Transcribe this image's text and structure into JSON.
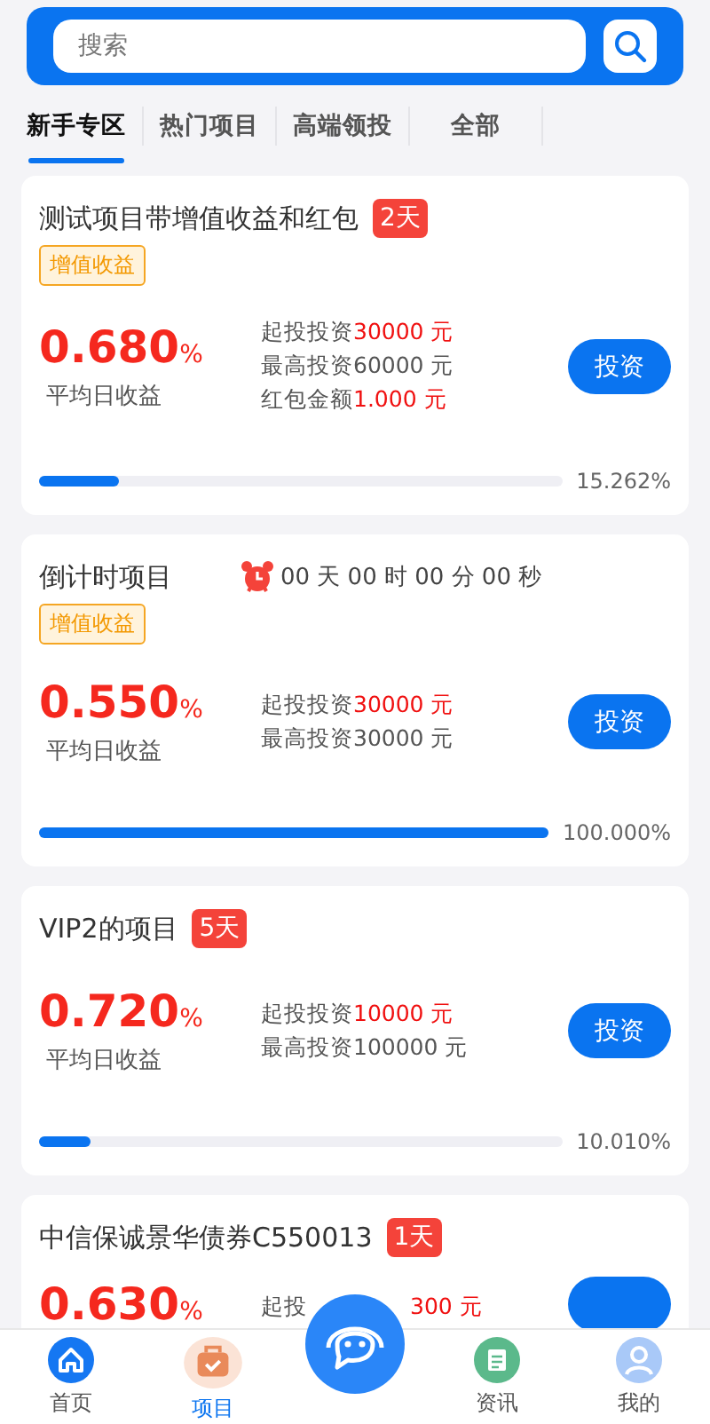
{
  "search": {
    "placeholder": "搜索"
  },
  "tabs": [
    {
      "label": "新手专区",
      "selected": true
    },
    {
      "label": "热门项目",
      "selected": false
    },
    {
      "label": "高端领投",
      "selected": false
    },
    {
      "label": "全部",
      "selected": false
    }
  ],
  "projects": [
    {
      "title": "测试项目带增值收益和红包",
      "days": "2天",
      "tag": "增值收益",
      "rate": "0.680",
      "rate_unit": "%",
      "rate_label": "平均日收益",
      "terms": [
        {
          "label": "起投投资",
          "amount": "30000 元",
          "highlight": true
        },
        {
          "label": "最高投资",
          "amount": "60000 元",
          "highlight": false
        },
        {
          "label": "红包金额",
          "amount": "1.000 元",
          "highlight": true
        }
      ],
      "button": "投资",
      "level": 0.15262,
      "progress": "15.262%"
    },
    {
      "title": "倒计时项目",
      "countdown": "00 天 00 时 00 分 00 秒",
      "tag": "增值收益",
      "rate": "0.550",
      "rate_unit": "%",
      "rate_label": "平均日收益",
      "terms": [
        {
          "label": "起投投资",
          "amount": "30000 元",
          "highlight": true
        },
        {
          "label": "最高投资",
          "amount": "30000 元",
          "highlight": false
        }
      ],
      "button": "投资",
      "level": 1,
      "progress": "100.000%"
    },
    {
      "title": "VIP2的项目",
      "days": "5天",
      "rate": "0.720",
      "rate_unit": "%",
      "rate_label": "平均日收益",
      "terms": [
        {
          "label": "起投投资",
          "amount": "10000 元",
          "highlight": true
        },
        {
          "label": "最高投资",
          "amount": "100000 元",
          "highlight": false
        }
      ],
      "button": "投资",
      "level": 0.1001,
      "progress": "10.010%"
    },
    {
      "title": "中信保诚景华债券C550013",
      "days": "1天",
      "rate": "0.630",
      "rate_unit": "%",
      "terms": [
        {
          "label": "起投",
          "amount": "300 元",
          "highlight": true,
          "covered": true
        }
      ]
    }
  ],
  "nav": [
    {
      "kind": "home",
      "label": "首页",
      "selected": false
    },
    {
      "kind": "project",
      "label": "项目",
      "selected": true
    },
    {
      "kind": "service"
    },
    {
      "kind": "news",
      "label": "资讯",
      "selected": false
    },
    {
      "kind": "me",
      "label": "我的",
      "selected": false
    }
  ]
}
